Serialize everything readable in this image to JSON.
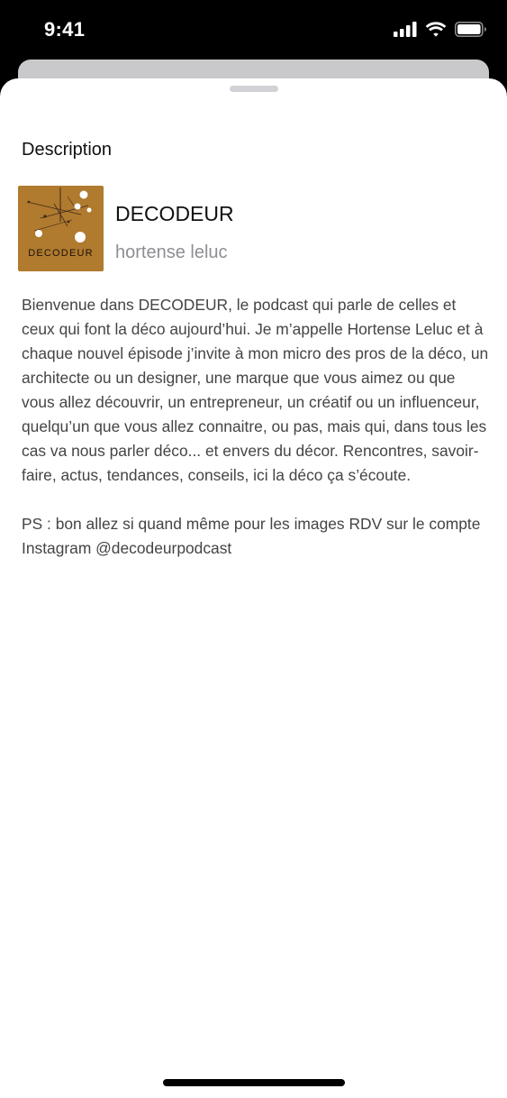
{
  "status_bar": {
    "time": "9:41",
    "icons": [
      "cellular-signal-icon",
      "wifi-icon",
      "battery-icon"
    ]
  },
  "sheet": {
    "title": "Description"
  },
  "podcast": {
    "name": "DECODEUR",
    "author": "hortense leluc",
    "artwork": {
      "label": "DECODEUR",
      "background_color": "#b07a2f"
    }
  },
  "description": {
    "paragraphs": [
      "Bienvenue dans DECODEUR, le podcast qui parle de celles et ceux qui font la déco aujourd’hui. Je m’appelle Hortense Leluc et à chaque nouvel épisode j’invite à mon micro des pros de la déco, un architecte ou un designer, une marque que vous aimez ou que vous allez découvrir, un entrepreneur, un créatif ou un influenceur, quelqu’un que vous allez connaitre, ou pas, mais qui, dans tous les cas va nous parler déco... et envers du décor. Rencontres, savoir-faire, actus, tendances, conseils, ici la déco ça s’écoute.",
      "PS : bon allez si quand même pour les images RDV sur le compte Instagram @decodeurpodcast"
    ]
  }
}
